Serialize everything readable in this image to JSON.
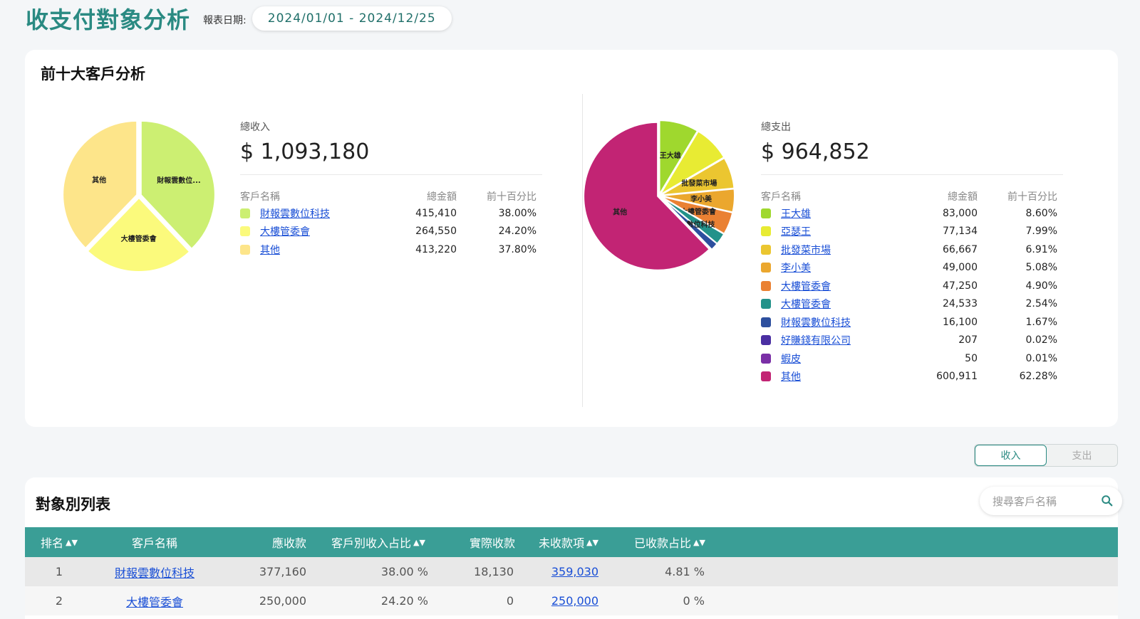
{
  "header": {
    "title": "收支付對象分析",
    "date_label": "報表日期:",
    "date_range": "2024/01/01 - 2024/12/25"
  },
  "top_card": {
    "title": "前十大客戶分析",
    "income": {
      "label": "總收入",
      "amount": "$ 1,093,180",
      "col_name": "客戶名稱",
      "col_amount": "總金額",
      "col_pct": "前十百分比",
      "items": [
        {
          "name": "財報雲數位科技",
          "amount": "415,410",
          "pct": "38.00%",
          "color": "#ccef72",
          "pie_label": "財報雲數位..."
        },
        {
          "name": "大樓管委會",
          "amount": "264,550",
          "pct": "24.20%",
          "color": "#fbfa7c",
          "pie_label": "大樓管委會"
        },
        {
          "name": "其他",
          "amount": "413,220",
          "pct": "37.80%",
          "color": "#fde58a",
          "pie_label": "其他"
        }
      ]
    },
    "expense": {
      "label": "總支出",
      "amount": "$ 964,852",
      "col_name": "客戶名稱",
      "col_amount": "總金額",
      "col_pct": "前十百分比",
      "items": [
        {
          "name": "王大雄",
          "amount": "83,000",
          "pct": "8.60%",
          "color": "#9fd82e",
          "pie_label": "王大雄"
        },
        {
          "name": "亞瑟王",
          "amount": "77,134",
          "pct": "7.99%",
          "color": "#e8eb33",
          "pie_label": ""
        },
        {
          "name": "批發菜市場",
          "amount": "66,667",
          "pct": "6.91%",
          "color": "#ebc630",
          "pie_label": "批發菜市場"
        },
        {
          "name": "李小美",
          "amount": "49,000",
          "pct": "5.08%",
          "color": "#eba72e",
          "pie_label": "李小美"
        },
        {
          "name": "大樓管委會",
          "amount": "47,250",
          "pct": "4.90%",
          "color": "#ea8133",
          "pie_label": "大樓管委會"
        },
        {
          "name": "大樓管委會",
          "amount": "24,533",
          "pct": "2.54%",
          "color": "#23928a",
          "pie_label": ""
        },
        {
          "name": "財報雲數位科技",
          "amount": "16,100",
          "pct": "1.67%",
          "color": "#2d4f9e",
          "pie_label": "財報雲數位科技"
        },
        {
          "name": "好賺錢有限公司",
          "amount": "207",
          "pct": "0.02%",
          "color": "#4a2fa2",
          "pie_label": ""
        },
        {
          "name": "蝦皮",
          "amount": "50",
          "pct": "0.01%",
          "color": "#7a2fa6",
          "pie_label": ""
        },
        {
          "name": "其他",
          "amount": "600,911",
          "pct": "62.28%",
          "color": "#c22474",
          "pie_label": "其他"
        }
      ]
    }
  },
  "toggle": {
    "income": "收入",
    "expense": "支出",
    "active": "income"
  },
  "list_card": {
    "title": "對象別列表",
    "search_placeholder": "搜尋客戶名稱",
    "columns": [
      "排名",
      "客戶名稱",
      "應收款",
      "客戶別收入占比",
      "實際收款",
      "未收款項",
      "已收款占比"
    ],
    "rows": [
      {
        "rank": "1",
        "name": "財報雲數位科技",
        "receivable": "377,160",
        "share": "38.00 %",
        "received": "18,130",
        "outstanding": "359,030",
        "received_pct": "4.81 %"
      },
      {
        "rank": "2",
        "name": "大樓管委會",
        "receivable": "250,000",
        "share": "24.20 %",
        "received": "0",
        "outstanding": "250,000",
        "received_pct": "0 %"
      }
    ]
  },
  "chart_data": [
    {
      "type": "pie",
      "categories": [
        "財報雲數位科技",
        "大樓管委會",
        "其他"
      ],
      "values": [
        38.0,
        24.2,
        37.8
      ]
    },
    {
      "type": "pie",
      "categories": [
        "王大雄",
        "亞瑟王",
        "批發菜市場",
        "李小美",
        "大樓管委會",
        "大樓管委會",
        "財報雲數位科技",
        "好賺錢有限公司",
        "蝦皮",
        "其他"
      ],
      "values": [
        8.6,
        7.99,
        6.91,
        5.08,
        4.9,
        2.54,
        1.67,
        0.02,
        0.01,
        62.28
      ]
    }
  ]
}
